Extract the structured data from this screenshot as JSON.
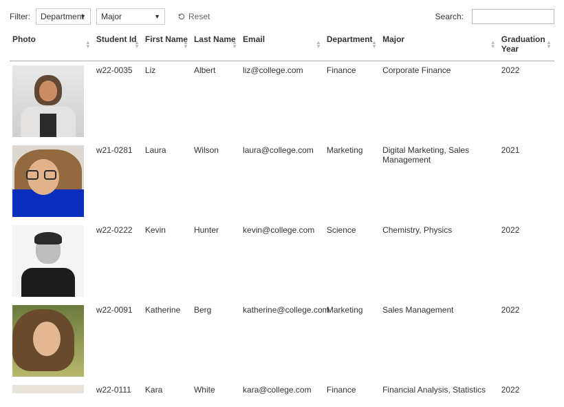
{
  "filters": {
    "label": "Filter:",
    "department": {
      "value": "Department"
    },
    "major": {
      "value": "Major"
    },
    "reset": "Reset"
  },
  "search": {
    "label": "Search:",
    "value": ""
  },
  "columns": {
    "photo": "Photo",
    "student_id": "Student Id",
    "first_name": "First Name",
    "last_name": "Last Name",
    "email": "Email",
    "department": "Department",
    "major": "Major",
    "grad_year": "Graduation Year"
  },
  "rows": [
    {
      "student_id": "w22-0035",
      "first_name": "Liz",
      "last_name": "Albert",
      "email": "liz@college.com",
      "department": "Finance",
      "major": "Corporate Finance",
      "grad_year": "2022",
      "photo_class": "liz"
    },
    {
      "student_id": "w21-0281",
      "first_name": "Laura",
      "last_name": "Wilson",
      "email": "laura@college.com",
      "department": "Marketing",
      "major": "Digital Marketing, Sales Management",
      "grad_year": "2021",
      "photo_class": "laura"
    },
    {
      "student_id": "w22-0222",
      "first_name": "Kevin",
      "last_name": "Hunter",
      "email": "kevin@college.com",
      "department": "Science",
      "major": "Chemistry, Physics",
      "grad_year": "2022",
      "photo_class": "kevin"
    },
    {
      "student_id": "w22-0091",
      "first_name": "Katherine",
      "last_name": "Berg",
      "email": "katherine@college.com",
      "department": "Marketing",
      "major": "Sales Management",
      "grad_year": "2022",
      "photo_class": "kath"
    },
    {
      "student_id": "w22-0111",
      "first_name": "Kara",
      "last_name": "White",
      "email": "kara@college.com",
      "department": "Finance",
      "major": "Financial Analysis, Statistics",
      "grad_year": "2022",
      "photo_class": ""
    }
  ]
}
